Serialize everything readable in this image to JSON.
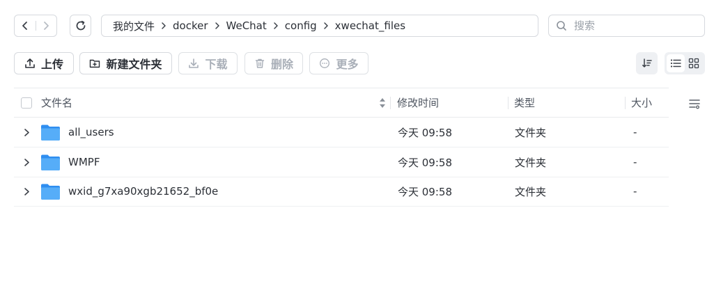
{
  "breadcrumb": [
    "我的文件",
    "docker",
    "WeChat",
    "config",
    "xwechat_files"
  ],
  "search": {
    "placeholder": "搜索"
  },
  "toolbar": {
    "upload": "上传",
    "new_folder": "新建文件夹",
    "download": "下载",
    "delete": "删除",
    "more": "更多"
  },
  "columns": {
    "name": "文件名",
    "modified": "修改时间",
    "type": "类型",
    "size": "大小"
  },
  "files": [
    {
      "name": "all_users",
      "modified": "今天 09:58",
      "type": "文件夹",
      "size": "-"
    },
    {
      "name": "WMPF",
      "modified": "今天 09:58",
      "type": "文件夹",
      "size": "-"
    },
    {
      "name": "wxid_g7xa90xgb21652_bf0e",
      "modified": "今天 09:58",
      "type": "文件夹",
      "size": "-"
    }
  ],
  "colors": {
    "folder": "#3d9bf5",
    "border": "#d6d9de",
    "active_view_bg": "#eef0f3"
  }
}
